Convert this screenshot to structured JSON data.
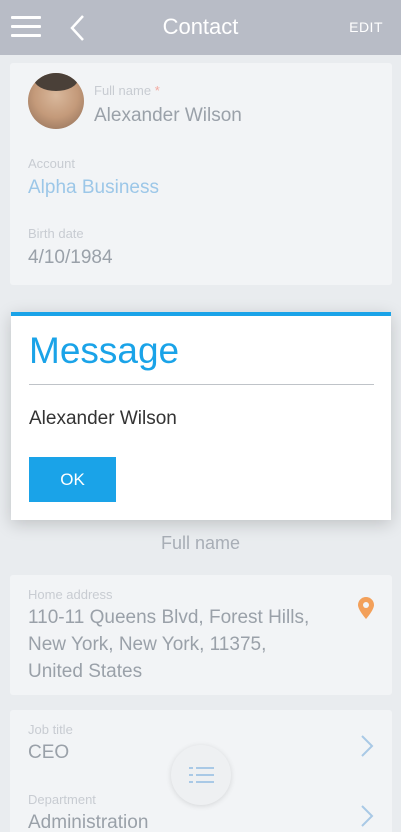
{
  "header": {
    "title": "Contact",
    "edit_label": "EDIT",
    "menu_icon": "hamburger-icon",
    "back_icon": "chevron-left-icon"
  },
  "contact": {
    "full_name_label": "Full name",
    "required_mark": "*",
    "full_name": "Alexander Wilson",
    "account_label": "Account",
    "account": "Alpha Business",
    "birth_date_label": "Birth date",
    "birth_date": "4/10/1984",
    "section_label": "Full name",
    "home_address_label": "Home address",
    "home_address_line1": "110-11 Queens Blvd, Forest Hills,",
    "home_address_line2": "New York, New York, 11375,",
    "home_address_line3": "United States",
    "job_title_label": "Job title",
    "job_title": "CEO",
    "department_label": "Department",
    "department": "Administration"
  },
  "dialog": {
    "title": "Message",
    "text": "Alexander Wilson",
    "ok_label": "OK"
  },
  "colors": {
    "accent": "#1aa3e8",
    "header_bg": "#b8bcc6",
    "pin": "#f3a05a"
  }
}
